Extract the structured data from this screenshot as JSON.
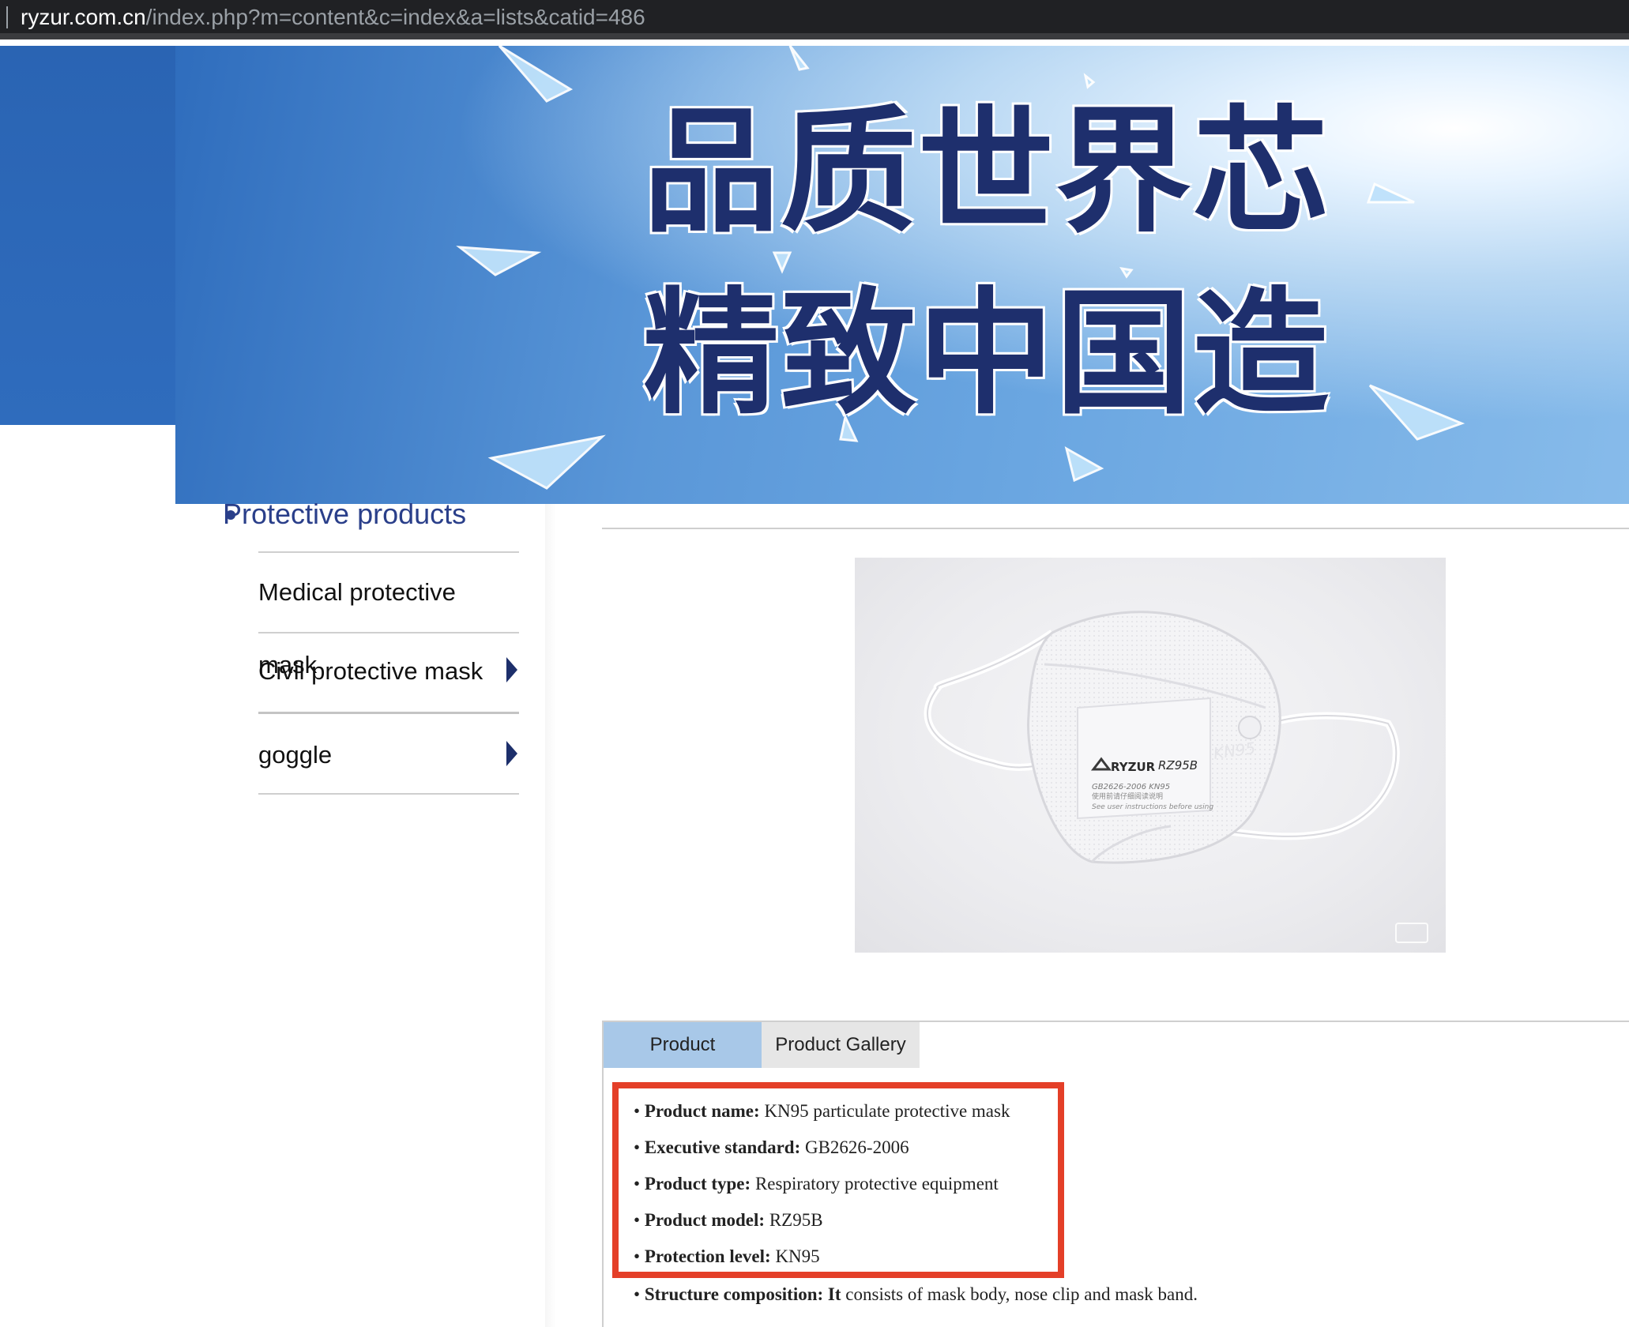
{
  "browser": {
    "url_host": "ryzur.com.cn",
    "url_path": "/index.php?m=content&c=index&a=lists&catid=486"
  },
  "banner": {
    "line1": "品质世界芯",
    "line2": "精致中国造"
  },
  "sidebar": {
    "parent": "Protective products",
    "items": [
      {
        "label": "Medical protective",
        "has_arrow": false
      },
      {
        "label": "Civil protective mask",
        "overlap_label": "mask",
        "has_arrow": true
      },
      {
        "label": "goggle",
        "has_arrow": true
      }
    ]
  },
  "product_image": {
    "brand": "RYZUR",
    "model": "RZ95B",
    "standard": "GB2626-2006 KN95",
    "chinese_note": "使用前请仔细阅读说明",
    "instruction": "See user instructions before using",
    "grade": "KN95"
  },
  "tabs": [
    {
      "label": "Product",
      "active": true
    },
    {
      "label": "Product Gallery",
      "active": false
    }
  ],
  "specs": [
    {
      "key": "Product name:",
      "value": "KN95 particulate protective mask"
    },
    {
      "key": "Executive standard:",
      "value": "GB2626-2006"
    },
    {
      "key": "Product type:",
      "value": "Respiratory protective equipment"
    },
    {
      "key": "Product model:",
      "value": "RZ95B"
    },
    {
      "key": "Protection level:",
      "value": "KN95"
    },
    {
      "key": "Structure composition: It",
      "value": "consists of mask body, nose clip and mask band."
    }
  ],
  "colors": {
    "highlight": "#e43f28",
    "nav_text": "#2a3f8a",
    "active_tab": "#a8c8e8",
    "banner_text": "#1e2f6d"
  }
}
